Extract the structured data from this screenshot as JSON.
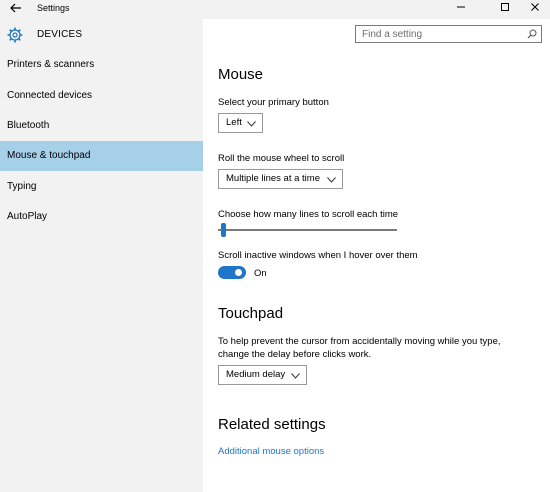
{
  "window": {
    "title": "Settings",
    "back_icon": "back-arrow-icon",
    "controls": {
      "minimize": "—",
      "maximize": "☐",
      "close": "✕"
    }
  },
  "sidebar": {
    "header_title": "DEVICES",
    "header_icon": "gear-icon",
    "items": [
      {
        "label": "Printers & scanners",
        "selected": false
      },
      {
        "label": "Connected devices",
        "selected": false
      },
      {
        "label": "Bluetooth",
        "selected": false
      },
      {
        "label": "Mouse & touchpad",
        "selected": true
      },
      {
        "label": "Typing",
        "selected": false
      },
      {
        "label": "AutoPlay",
        "selected": false
      }
    ]
  },
  "search": {
    "placeholder": "Find a setting",
    "value": ""
  },
  "mouse": {
    "heading": "Mouse",
    "primary_button_label": "Select your primary button",
    "primary_button_value": "Left",
    "scroll_label": "Roll the mouse wheel to scroll",
    "scroll_value": "Multiple lines at a time",
    "lines_label": "Choose how many lines to scroll each time",
    "lines_slider_level": 0.02,
    "inactive_label": "Scroll inactive windows when I hover over them",
    "inactive_state": "On"
  },
  "touchpad": {
    "heading": "Touchpad",
    "description": "To help prevent the cursor from accidentally moving while you type, change the delay before clicks work.",
    "delay_value": "Medium delay"
  },
  "related": {
    "heading": "Related settings",
    "link": "Additional mouse options"
  },
  "colors": {
    "accent": "#1f76c4",
    "selected_nav": "#a6cfe8",
    "sidebar_bg": "#f2f2f2"
  }
}
